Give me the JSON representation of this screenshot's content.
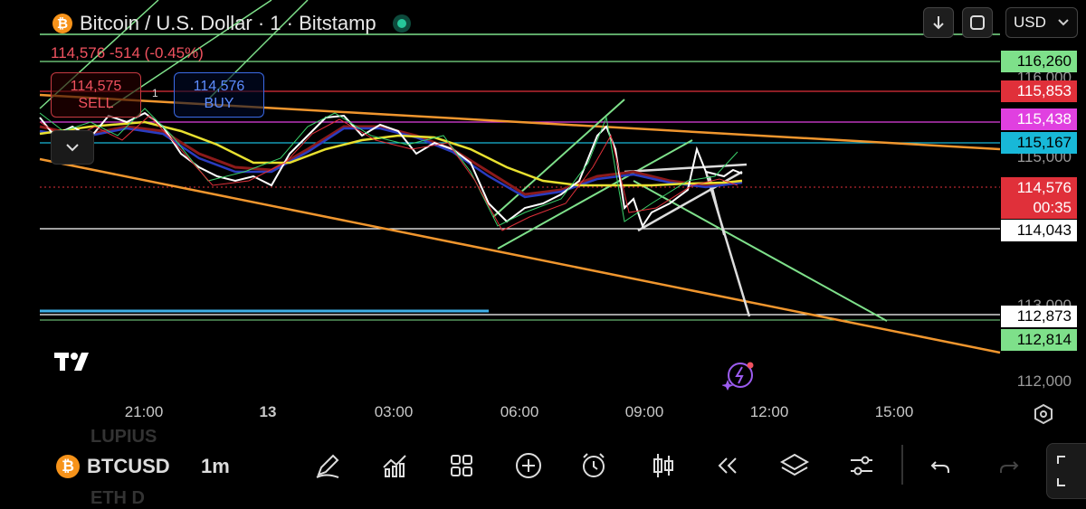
{
  "header": {
    "symbol_title": "Bitcoin / U.S. Dollar · 1 · Bitstamp",
    "currency": "USD",
    "price_change": "114,576  -514 (-0.45%)"
  },
  "trade": {
    "sell_price": "114,575",
    "sell_label": "SELL",
    "buy_price": "114,576",
    "buy_label": "BUY",
    "quantity": "1"
  },
  "price_labels": [
    {
      "text": "116,260",
      "bg": "#7ee08a",
      "fg": "#000000"
    },
    {
      "text": "115,853",
      "bg": "#e0303a",
      "fg": "#ffffff"
    },
    {
      "text": "115,438",
      "bg": "#e040e0",
      "fg": "#ffffff"
    },
    {
      "text": "115,167",
      "bg": "#18b8d8",
      "fg": "#000000"
    },
    {
      "text": "114,576",
      "bg": "#e0303a",
      "fg": "#ffffff"
    },
    {
      "text": "00:35",
      "bg": "#e0303a",
      "fg": "#ffffff"
    },
    {
      "text": "114,043",
      "bg": "#ffffff",
      "fg": "#000000"
    },
    {
      "text": "112,873",
      "bg": "#ffffff",
      "fg": "#000000"
    },
    {
      "text": "112,814",
      "bg": "#7ee08a",
      "fg": "#000000"
    }
  ],
  "price_axis": {
    "ticks": [
      "116,000",
      "115,000",
      "113,000",
      "112,000"
    ]
  },
  "time_axis": {
    "labels": [
      "21:00",
      "13",
      "03:00",
      "06:00",
      "09:00",
      "12:00",
      "15:00"
    ]
  },
  "bottom_bar": {
    "symbol": "BTCUSD",
    "interval": "1m",
    "faded_above": "LUPIUS",
    "faded_below": "ETH D"
  },
  "icons": [
    "down-arrow-icon",
    "fullscreen-icon",
    "chevron-down-icon",
    "settings-hex-icon",
    "pencil-icon",
    "indicators-icon",
    "grid-icon",
    "plus-circle-icon",
    "alarm-icon",
    "candles-icon",
    "replay-icon",
    "layers-icon",
    "sliders-icon",
    "undo-icon",
    "redo-icon"
  ],
  "colors": {
    "sell": "#f0525f",
    "buy": "#5d8cff",
    "orange_trend": "#f0962e",
    "green_line": "#7ee08a"
  }
}
